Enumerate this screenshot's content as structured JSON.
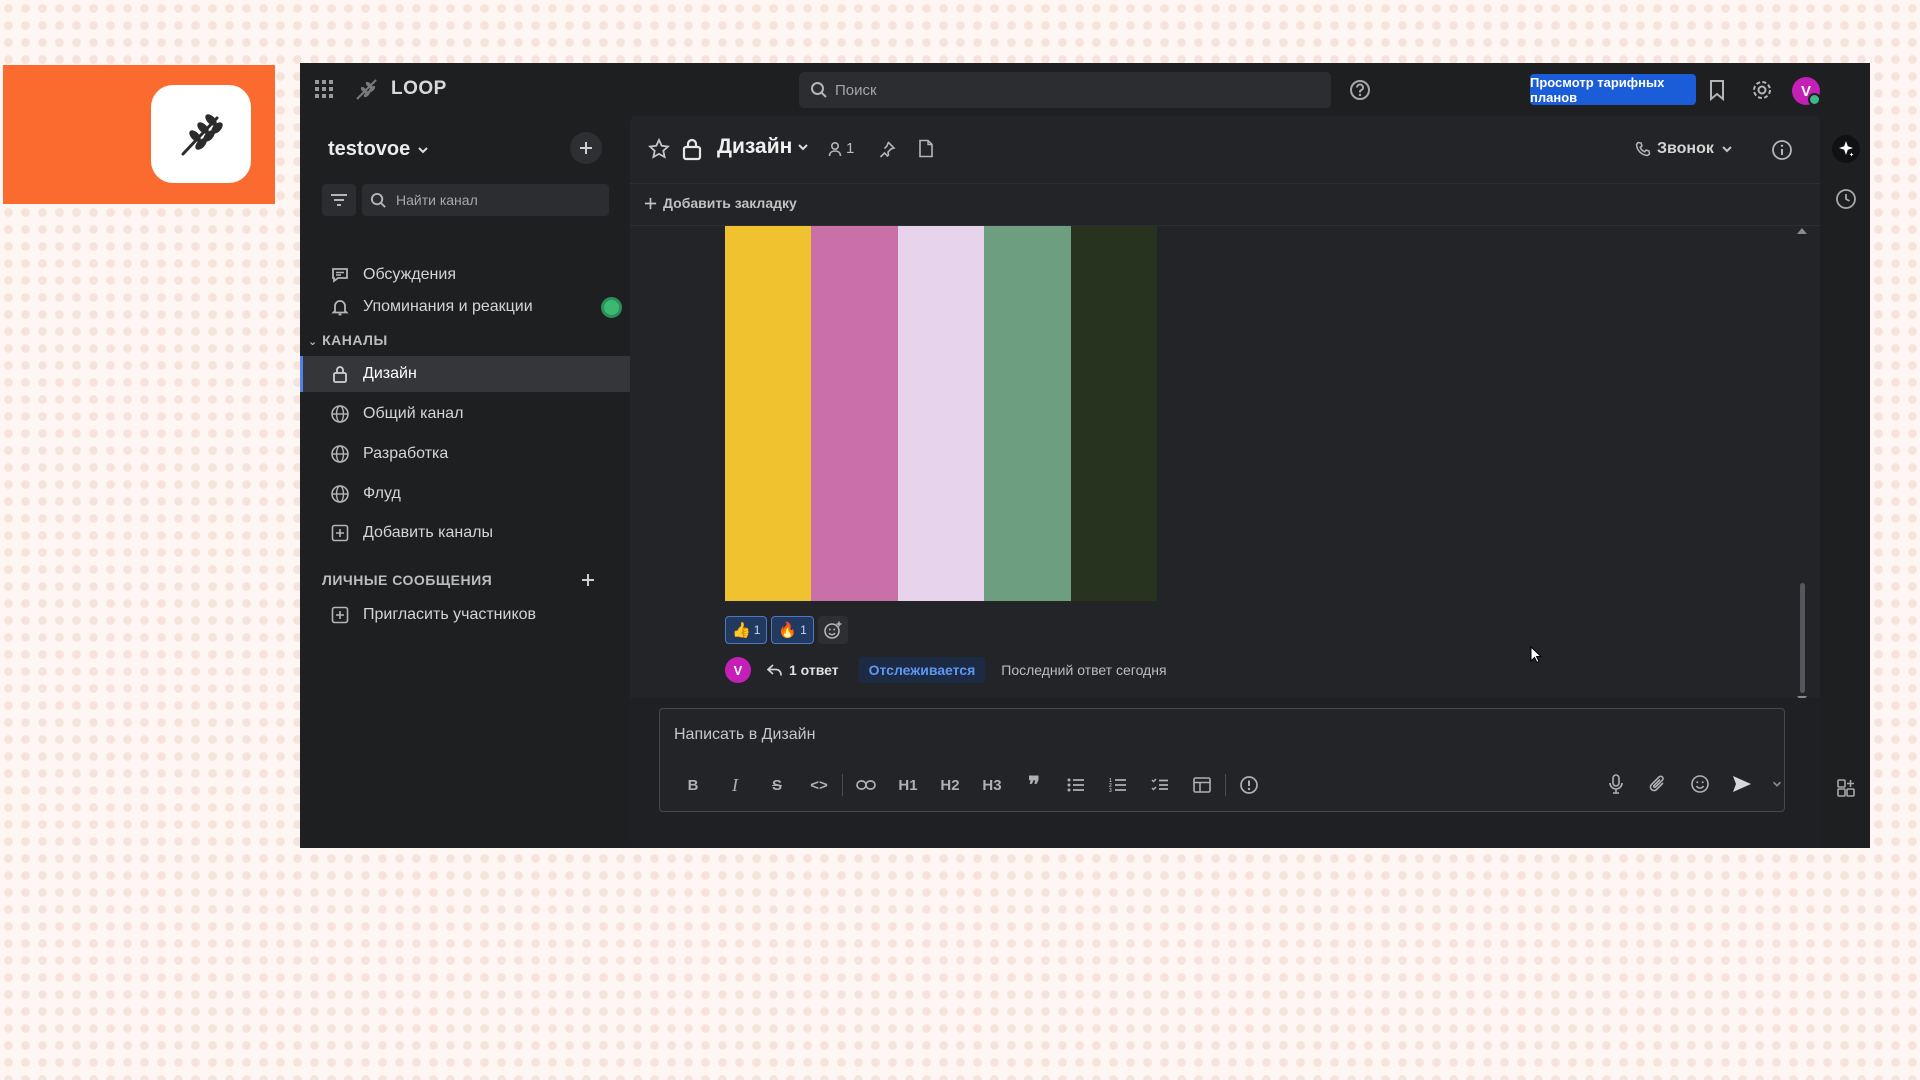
{
  "app": {
    "brand": "LOOP",
    "search_placeholder": "Поиск",
    "plans_button": "Просмотр тарифных планов",
    "user_initial": "V"
  },
  "sidebar": {
    "team_name": "testovoe",
    "find_channel_placeholder": "Найти канал",
    "items": [
      {
        "label": "Обсуждения",
        "icon": "threads-icon"
      },
      {
        "label": "Упоминания и реакции",
        "icon": "bell-icon"
      }
    ],
    "channels_header": "КАНАЛЫ",
    "channels": [
      {
        "label": "Дизайн",
        "icon": "lock-icon",
        "active": true
      },
      {
        "label": "Общий канал",
        "icon": "globe-icon"
      },
      {
        "label": "Разработка",
        "icon": "globe-icon"
      },
      {
        "label": "Флуд",
        "icon": "globe-icon"
      }
    ],
    "add_channels": "Добавить каналы",
    "dm_header": "ЛИЧНЫЕ СООБЩЕНИЯ",
    "invite": "Пригласить участников"
  },
  "channel": {
    "name": "Дизайн",
    "member_count": "1",
    "call_label": "Звонок",
    "add_bookmark": "Добавить закладку",
    "palette_colors": [
      "#f0c22f",
      "#c970a8",
      "#e8d3ec",
      "#6e9e80",
      "#27321f"
    ],
    "reactions": [
      {
        "emoji": "👍",
        "count": "1"
      },
      {
        "emoji": "🔥",
        "count": "1"
      }
    ],
    "thread": {
      "avatar_initial": "V",
      "reply_count": "1 ответ",
      "following": "Отслеживается",
      "last_reply": "Последний ответ сегодня"
    },
    "composer_placeholder": "Написать в Дизайн",
    "format_buttons": [
      "B",
      "I",
      "S",
      "<>",
      "link",
      "H1",
      "H2",
      "H3",
      "quote",
      "ul",
      "ol",
      "checklist",
      "table",
      "info"
    ]
  },
  "colors": {
    "accent": "#1b5cd8",
    "brand_orange": "#fb6a2f",
    "online": "#3db887"
  }
}
